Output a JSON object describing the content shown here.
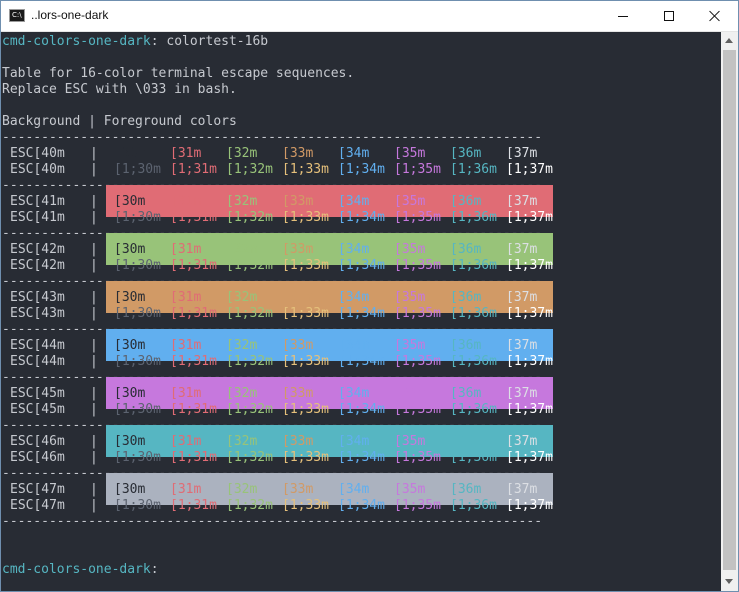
{
  "window": {
    "title": "..lors-one-dark",
    "icon": "console-app-icon",
    "icon_text": "C:\\",
    "controls": [
      "minimize-icon",
      "maximize-icon",
      "close-icon"
    ]
  },
  "console": {
    "prompt_text": "cmd-colors-one-dark",
    "command_line": ": colortest-16b",
    "desc_line1": "Table for 16-color terminal escape sequences.",
    "desc_line2": "Replace ESC with \\033 in bash.",
    "header": "Background | Foreground colors",
    "separator": "---------------------------------------------------------------------",
    "final_prompt_suffix": ":"
  },
  "foreground_codes": [
    "[30m",
    "[31m",
    "[32m",
    "[33m",
    "[34m",
    "[35m",
    "[36m",
    "[37m"
  ],
  "bold_codes": [
    "[1;30m",
    "[1;31m",
    "[1;32m",
    "[1;33m",
    "[1;34m",
    "[1;35m",
    "[1;36m",
    "[1;37m"
  ],
  "rows": [
    {
      "label": "ESC[40m",
      "bg": "#282c34"
    },
    {
      "label": "ESC[41m",
      "bg": "#e06c75"
    },
    {
      "label": "ESC[42m",
      "bg": "#98c379"
    },
    {
      "label": "ESC[43m",
      "bg": "#d19a66"
    },
    {
      "label": "ESC[44m",
      "bg": "#61afef"
    },
    {
      "label": "ESC[45m",
      "bg": "#c678dd"
    },
    {
      "label": "ESC[46m",
      "bg": "#56b6c2"
    },
    {
      "label": "ESC[47m",
      "bg": "#abb2bf"
    }
  ],
  "colors": {
    "normal": [
      "#282c34",
      "#e06c75",
      "#98c379",
      "#d19a66",
      "#61afef",
      "#c678dd",
      "#56b6c2",
      "#dcdfe4"
    ],
    "bold": [
      "#5c6370",
      "#e06c75",
      "#98c379",
      "#e5c07b",
      "#61afef",
      "#c678dd",
      "#56b6c2",
      "#ffffff"
    ],
    "text": "#c6c9cf",
    "prompt": "#56b6c2",
    "background": "#282c34"
  }
}
